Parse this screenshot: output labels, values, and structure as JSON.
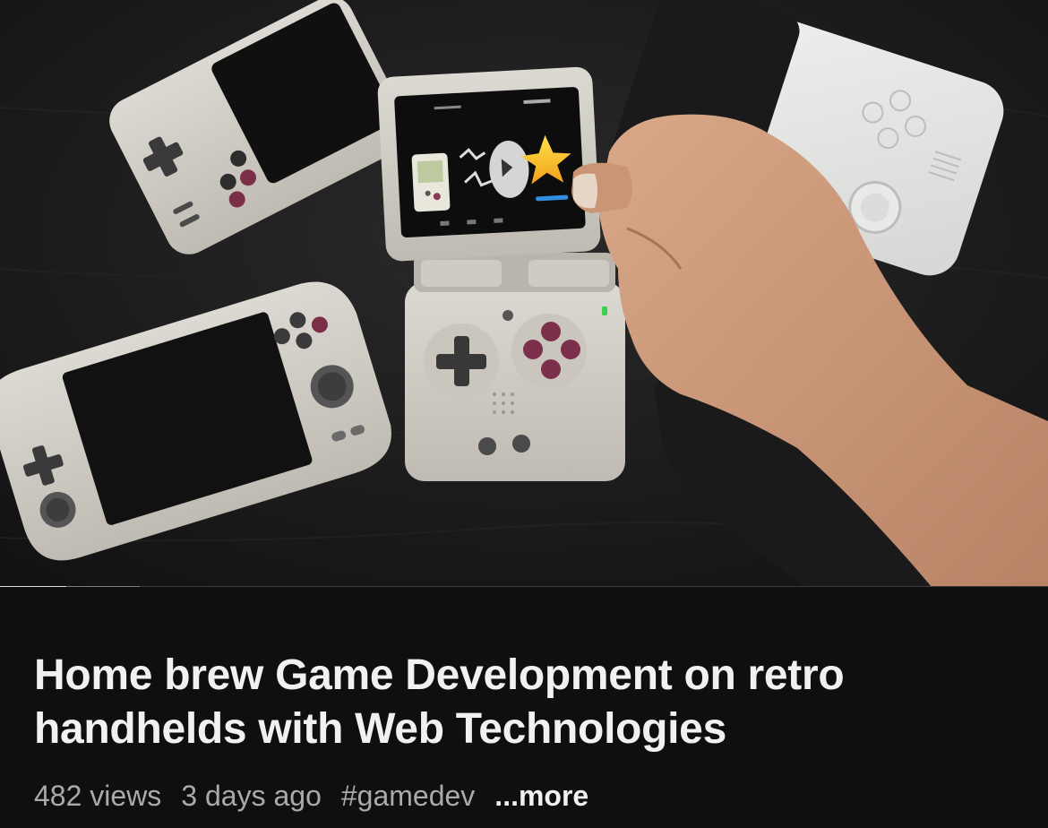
{
  "video": {
    "thumbnail_icon": "video-frame-retro-handhelds",
    "progress": {
      "played_fraction": 0.063,
      "buffered_fraction": 0.133
    }
  },
  "details": {
    "title": "Home brew Game Development on retro handhelds with Web Technologies",
    "views": "482 views",
    "age": "3 days ago",
    "hashtag": "#gamedev",
    "more_label": "...more"
  },
  "colors": {
    "background": "#0f0f0f",
    "title_text": "#f1f1f1",
    "meta_text": "#aaaaaa",
    "progress_played": "#d8d8d8",
    "progress_buffered": "#7a7a7a",
    "progress_track": "#3d3d3d"
  }
}
